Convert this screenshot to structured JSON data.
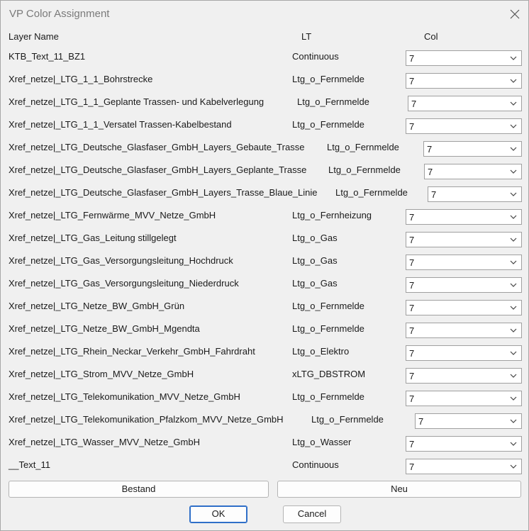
{
  "window": {
    "title": "VP Color Assignment"
  },
  "headers": {
    "layer_name": "Layer Name",
    "lt": "LT",
    "col": "Col"
  },
  "rows": [
    {
      "name": "KTB_Text_11_BZ1",
      "lt": "Continuous",
      "col": "7"
    },
    {
      "name": "Xref_netze|_LTG_1_1_Bohrstrecke",
      "lt": "Ltg_o_Fernmelde",
      "col": "7"
    },
    {
      "name": "Xref_netze|_LTG_1_1_Geplante Trassen- und Kabelverlegung",
      "lt": "Ltg_o_Fernmelde",
      "col": "7"
    },
    {
      "name": "Xref_netze|_LTG_1_1_Versatel Trassen-Kabelbestand",
      "lt": "Ltg_o_Fernmelde",
      "col": "7"
    },
    {
      "name": "Xref_netze|_LTG_Deutsche_Glasfaser_GmbH_Layers_Gebaute_Trasse",
      "lt": "Ltg_o_Fernmelde",
      "col": "7"
    },
    {
      "name": "Xref_netze|_LTG_Deutsche_Glasfaser_GmbH_Layers_Geplante_Trasse",
      "lt": "Ltg_o_Fernmelde",
      "col": "7"
    },
    {
      "name": "Xref_netze|_LTG_Deutsche_Glasfaser_GmbH_Layers_Trasse_Blaue_Linie",
      "lt": "Ltg_o_Fernmelde",
      "col": "7"
    },
    {
      "name": "Xref_netze|_LTG_Fernwärme_MVV_Netze_GmbH",
      "lt": "Ltg_o_Fernheizung",
      "col": "7"
    },
    {
      "name": "Xref_netze|_LTG_Gas_Leitung stillgelegt",
      "lt": "Ltg_o_Gas",
      "col": "7"
    },
    {
      "name": "Xref_netze|_LTG_Gas_Versorgungsleitung_Hochdruck",
      "lt": "Ltg_o_Gas",
      "col": "7"
    },
    {
      "name": "Xref_netze|_LTG_Gas_Versorgungsleitung_Niederdruck",
      "lt": "Ltg_o_Gas",
      "col": "7"
    },
    {
      "name": "Xref_netze|_LTG_Netze_BW_GmbH_Grün",
      "lt": "Ltg_o_Fernmelde",
      "col": "7"
    },
    {
      "name": "Xref_netze|_LTG_Netze_BW_GmbH_Mgendta",
      "lt": "Ltg_o_Fernmelde",
      "col": "7"
    },
    {
      "name": "Xref_netze|_LTG_Rhein_Neckar_Verkehr_GmbH_Fahrdraht",
      "lt": "Ltg_o_Elektro",
      "col": "7"
    },
    {
      "name": "Xref_netze|_LTG_Strom_MVV_Netze_GmbH",
      "lt": "xLTG_DBSTROM",
      "col": "7"
    },
    {
      "name": "Xref_netze|_LTG_Telekomunikation_MVV_Netze_GmbH",
      "lt": "Ltg_o_Fernmelde",
      "col": "7"
    },
    {
      "name": "Xref_netze|_LTG_Telekomunikation_Pfalzkom_MVV_Netze_GmbH",
      "lt": "Ltg_o_Fernmelde",
      "col": "7"
    },
    {
      "name": "Xref_netze|_LTG_Wasser_MVV_Netze_GmbH",
      "lt": "Ltg_o_Wasser",
      "col": "7"
    },
    {
      "name": "__Text_11",
      "lt": "Continuous",
      "col": "7"
    }
  ],
  "buttons": {
    "bestand": "Bestand",
    "neu": "Neu",
    "ok": "OK",
    "cancel": "Cancel"
  },
  "icons": {
    "close": "close-icon",
    "dropdown": "chevron-down-icon"
  },
  "colors": {
    "background": "#f0f0f0",
    "ok_border": "#2f6fc8",
    "title": "#7a7a7a"
  }
}
